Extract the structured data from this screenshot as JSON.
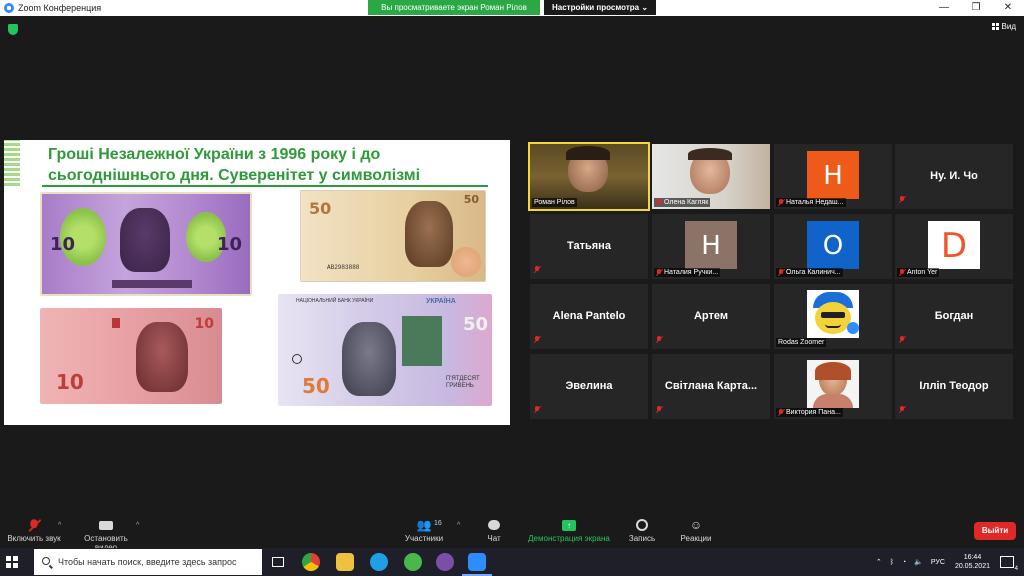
{
  "window": {
    "title": "Zoom Конференция",
    "share_banner": "Вы просматриваете экран Роман Рілов",
    "view_options": "Настройки просмотра ⌄",
    "controls": [
      "—",
      "❐",
      "✕"
    ]
  },
  "topbar": {
    "view_label": "Вид"
  },
  "slide": {
    "title": "Гроші Незалежної України з 1996 року і до сьогоднішнього дня. Суверенітет у символізмі",
    "notes": [
      {
        "value": "10",
        "color": "#b58bd0"
      },
      {
        "value": "50",
        "color": "#e6c99e",
        "serial": "АВ2983888"
      },
      {
        "value": "10",
        "color": "#e3a0a0"
      },
      {
        "value": "50",
        "color": "#cfc7e8",
        "bank": "НАЦІОНАЛЬНИЙ БАНК УКРАЇНИ",
        "country": "УКРАЇНА",
        "words": "П'ЯТДЕСЯТ ГРИВЕНЬ"
      }
    ]
  },
  "participants": [
    {
      "name": "Роман Рілов",
      "type": "video",
      "muted": false,
      "active": true
    },
    {
      "name": "Олена Кагляк",
      "type": "video",
      "muted": true
    },
    {
      "name": "Наталья Недаш...",
      "type": "avatar",
      "letter": "Н",
      "color": "#ee5a1a",
      "muted": true
    },
    {
      "name": "Ну. И. Чо",
      "type": "text",
      "muted": true
    },
    {
      "name": "Татьяна",
      "type": "text",
      "muted": true
    },
    {
      "name": "Наталия Ручки...",
      "type": "avatar",
      "letter": "Н",
      "color": "#8b7467",
      "muted": true
    },
    {
      "name": "Ольга Калинич...",
      "type": "avatar",
      "letter": "О",
      "color": "#1064c9",
      "muted": true
    },
    {
      "name": "Anton Yer",
      "type": "avatar",
      "letter": "D",
      "color": "#f0542a",
      "muted": true
    },
    {
      "name": "Alena Pantelo",
      "type": "text",
      "muted": true
    },
    {
      "name": "Артем",
      "type": "text",
      "muted": true
    },
    {
      "name": "Rodas Zoomer",
      "type": "emoji",
      "muted": false
    },
    {
      "name": "Богдан",
      "type": "text",
      "muted": true
    },
    {
      "name": "Эвелина",
      "type": "text",
      "muted": true
    },
    {
      "name": "Світлана Карта...",
      "type": "text",
      "muted": true
    },
    {
      "name": "Виктория Пана...",
      "type": "photo",
      "muted": true
    },
    {
      "name": "Ілліn Теодор",
      "type": "text",
      "muted": true
    }
  ],
  "toolbar": {
    "audio": "Включить звук",
    "video": "Остановить видео",
    "participants": "Участники",
    "participants_count": "16",
    "chat": "Чат",
    "share": "Демонстрация экрана",
    "record": "Запись",
    "reactions": "Реакции",
    "leave": "Выйти"
  },
  "taskbar": {
    "search_placeholder": "Чтобы начать поиск, введите здесь запрос",
    "lang": "РУС",
    "time": "16:44",
    "date": "20.05.2021",
    "notifications": "4"
  }
}
